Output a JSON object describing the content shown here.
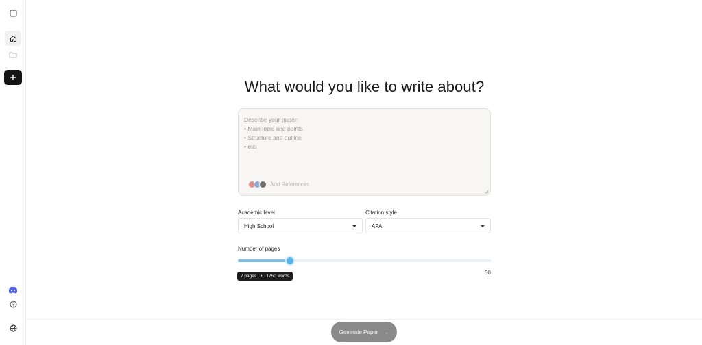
{
  "sidebar": {
    "toggle_icon": "panel-toggle-icon",
    "home_icon": "home-icon",
    "folder_icon": "folder-icon",
    "new_icon": "plus-icon",
    "discord_icon": "discord-icon",
    "help_icon": "help-circle-icon",
    "language_icon": "globe-icon"
  },
  "main": {
    "title": "What would you like to write about?",
    "prompt": {
      "placeholder": "Describe your paper:\n• Main topic and points\n• Structure and outline\n• etc.",
      "add_references_label": "Add References"
    },
    "academic_level": {
      "label": "Academic level",
      "value": "High School"
    },
    "citation_style": {
      "label": "Citation style",
      "value": "APA"
    },
    "pages": {
      "label": "Number of pages",
      "value": 7,
      "max_label": "50",
      "tooltip_pages": "7 pages",
      "tooltip_sep": "•",
      "tooltip_words": "1750 words"
    },
    "generate_label": "Generate Paper",
    "generate_arrow": "→"
  },
  "colors": {
    "accent": "#55b6ea",
    "button_disabled": "#8a8a8a",
    "discord": "#5865f2"
  }
}
